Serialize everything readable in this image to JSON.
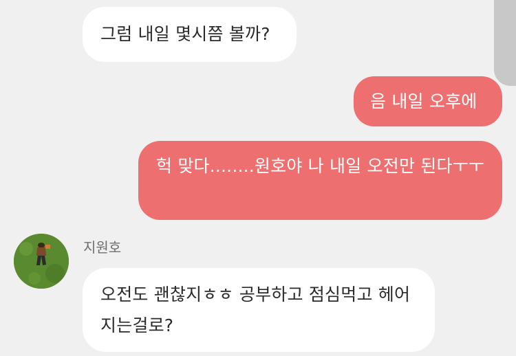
{
  "messages": [
    {
      "direction": "in",
      "text": "그럼 내일 몇시쯤 볼까?"
    },
    {
      "direction": "out",
      "text": "음 내일 오후에"
    },
    {
      "direction": "out",
      "text": "헉 맞다........원호야 나 내일 오전만 된다ㅜㅜ"
    },
    {
      "direction": "in",
      "sender": "지원호",
      "text": "오전도 괜찮지ㅎㅎ 공부하고 점심먹고 헤어지는걸로?"
    }
  ],
  "colors": {
    "background": "#f0f0f0",
    "incoming_bubble": "#ffffff",
    "outgoing_bubble": "#ee6f6f",
    "scrollbar": "#c8c8c8"
  }
}
